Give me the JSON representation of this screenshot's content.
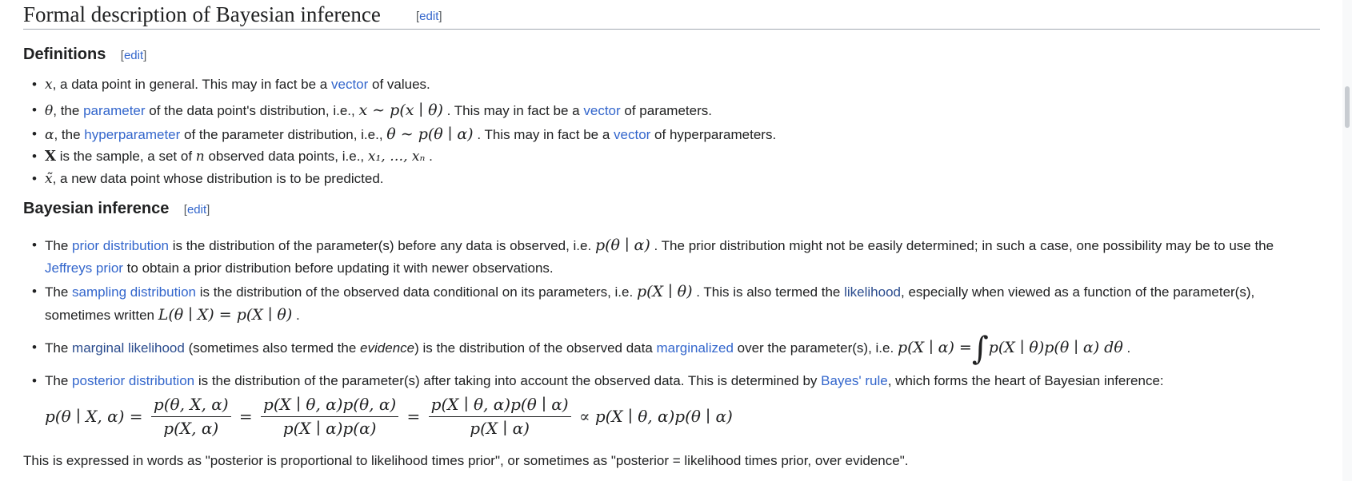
{
  "section": {
    "title": "Formal description of Bayesian inference",
    "edit_label": "edit"
  },
  "definitions": {
    "title": "Definitions",
    "edit_label": "edit",
    "items": [
      {
        "m1": "x",
        "t1": ", a data point in general. This may in fact be a ",
        "l1": "vector",
        "t2": " of values."
      },
      {
        "m1": "θ",
        "t1": ", the ",
        "l1": "parameter",
        "t2": " of the data point's distribution, i.e., ",
        "m2": "x ∼ p(x ∣ θ)",
        "t3": " . This may in fact be a ",
        "l2": "vector",
        "t4": " of parameters."
      },
      {
        "m1": "α",
        "t1": ", the ",
        "l1": "hyperparameter",
        "t2": " of the parameter distribution, i.e., ",
        "m2": "θ ∼ p(θ ∣ α)",
        "t3": " . This may in fact be a ",
        "l2": "vector",
        "t4": " of hyperparameters."
      },
      {
        "m1": "X",
        "t1": " is the sample, a set of ",
        "m2": "n",
        "t2": " observed data points, i.e., ",
        "m3": "x₁, …, xₙ",
        "t3": " ."
      },
      {
        "m1": "x̃",
        "t1": ", a new data point whose distribution is to be predicted."
      }
    ]
  },
  "bayesian": {
    "title": "Bayesian inference",
    "edit_label": "edit",
    "prior": {
      "t1": "The ",
      "l1": "prior distribution",
      "t2": " is the distribution of the parameter(s) before any data is observed, i.e. ",
      "m1": "p(θ ∣ α)",
      "t3": " . The prior distribution might not be easily determined; in such a case, one possibility may be to use the",
      "l2": "Jeffreys prior",
      "t4": " to obtain a prior distribution before updating it with newer observations."
    },
    "sampling": {
      "t1": "The ",
      "l1": "sampling distribution",
      "t2": " is the distribution of the observed data conditional on its parameters, i.e. ",
      "m1": "p(X ∣ θ)",
      "t3": " . This is also termed the ",
      "l2": "likelihood",
      "t4": ", especially when viewed as a function of the parameter(s),",
      "t5": "sometimes written ",
      "m2": "L(θ ∣ X) = p(X ∣ θ)",
      "t6": " ."
    },
    "marginal": {
      "t1": "The ",
      "l1": "marginal likelihood",
      "t2": " (sometimes also termed the ",
      "em": "evidence",
      "t3": ") is the distribution of the observed data ",
      "l2": "marginalized",
      "t4": " over the parameter(s), i.e. ",
      "m1": "p(X ∣ α) =",
      "m2": "∫",
      "m3": "p(X ∣ θ)p(θ ∣ α) dθ",
      "t5": " ."
    },
    "posterior": {
      "t1": "The ",
      "l1": "posterior distribution",
      "t2": " is the distribution of the parameter(s) after taking into account the observed data. This is determined by ",
      "l2": "Bayes' rule",
      "t3": ", which forms the heart of Bayesian inference:"
    },
    "equation": {
      "lhs": "p(θ ∣ X, α) =",
      "f1_num": "p(θ, X, α)",
      "f1_den": "p(X, α)",
      "eq2": "=",
      "f2_num": "p(X ∣ θ, α)p(θ, α)",
      "f2_den": "p(X ∣ α)p(α)",
      "eq3": "=",
      "f3_num": "p(X ∣ θ, α)p(θ ∣ α)",
      "f3_den": "p(X ∣ α)",
      "rhs": "∝ p(X ∣ θ, α)p(θ ∣ α)"
    },
    "words": "This is expressed in words as \"posterior is proportional to likelihood times prior\", or sometimes as \"posterior = likelihood times prior, over evidence\"."
  }
}
